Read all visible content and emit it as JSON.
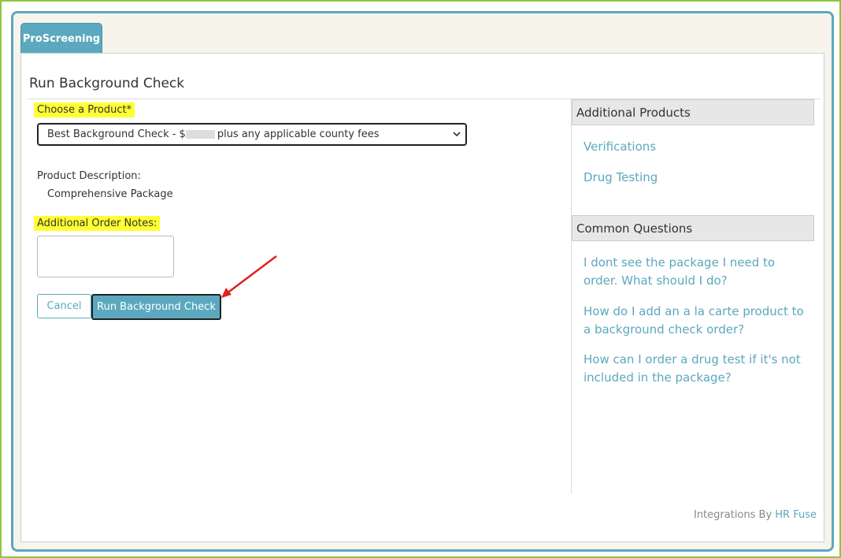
{
  "app": {
    "tab_label": "ProScreening"
  },
  "page": {
    "title": "Run Background Check"
  },
  "form": {
    "product_label": "Choose a Product*",
    "product_selected_prefix": "Best Background Check - $",
    "product_selected_suffix": "plus any applicable county fees",
    "description_label": "Product Description:",
    "description_value": "Comprehensive Package",
    "notes_label": "Additional Order Notes:",
    "notes_value": "",
    "cancel_label": "Cancel",
    "submit_label": "Run Background Check"
  },
  "sidebar": {
    "products_header": "Additional Products",
    "products": [
      "Verifications",
      "Drug Testing"
    ],
    "questions_header": "Common Questions",
    "questions": [
      "I dont see the package I need to order. What should I do?",
      "How do I add an a la carte product to a background check order?",
      "How can I order a drug test if it's not included in the package?"
    ]
  },
  "footer": {
    "prefix": "Integrations By",
    "link": "HR Fuse"
  },
  "colors": {
    "accent": "#5ba8bf",
    "highlight": "#ffff33",
    "outer_border": "#8cc63f",
    "annotation_arrow": "#e02020"
  },
  "icons": {
    "select_arrow": "chevron-down-icon",
    "annotation": "red-arrow-annotation"
  }
}
